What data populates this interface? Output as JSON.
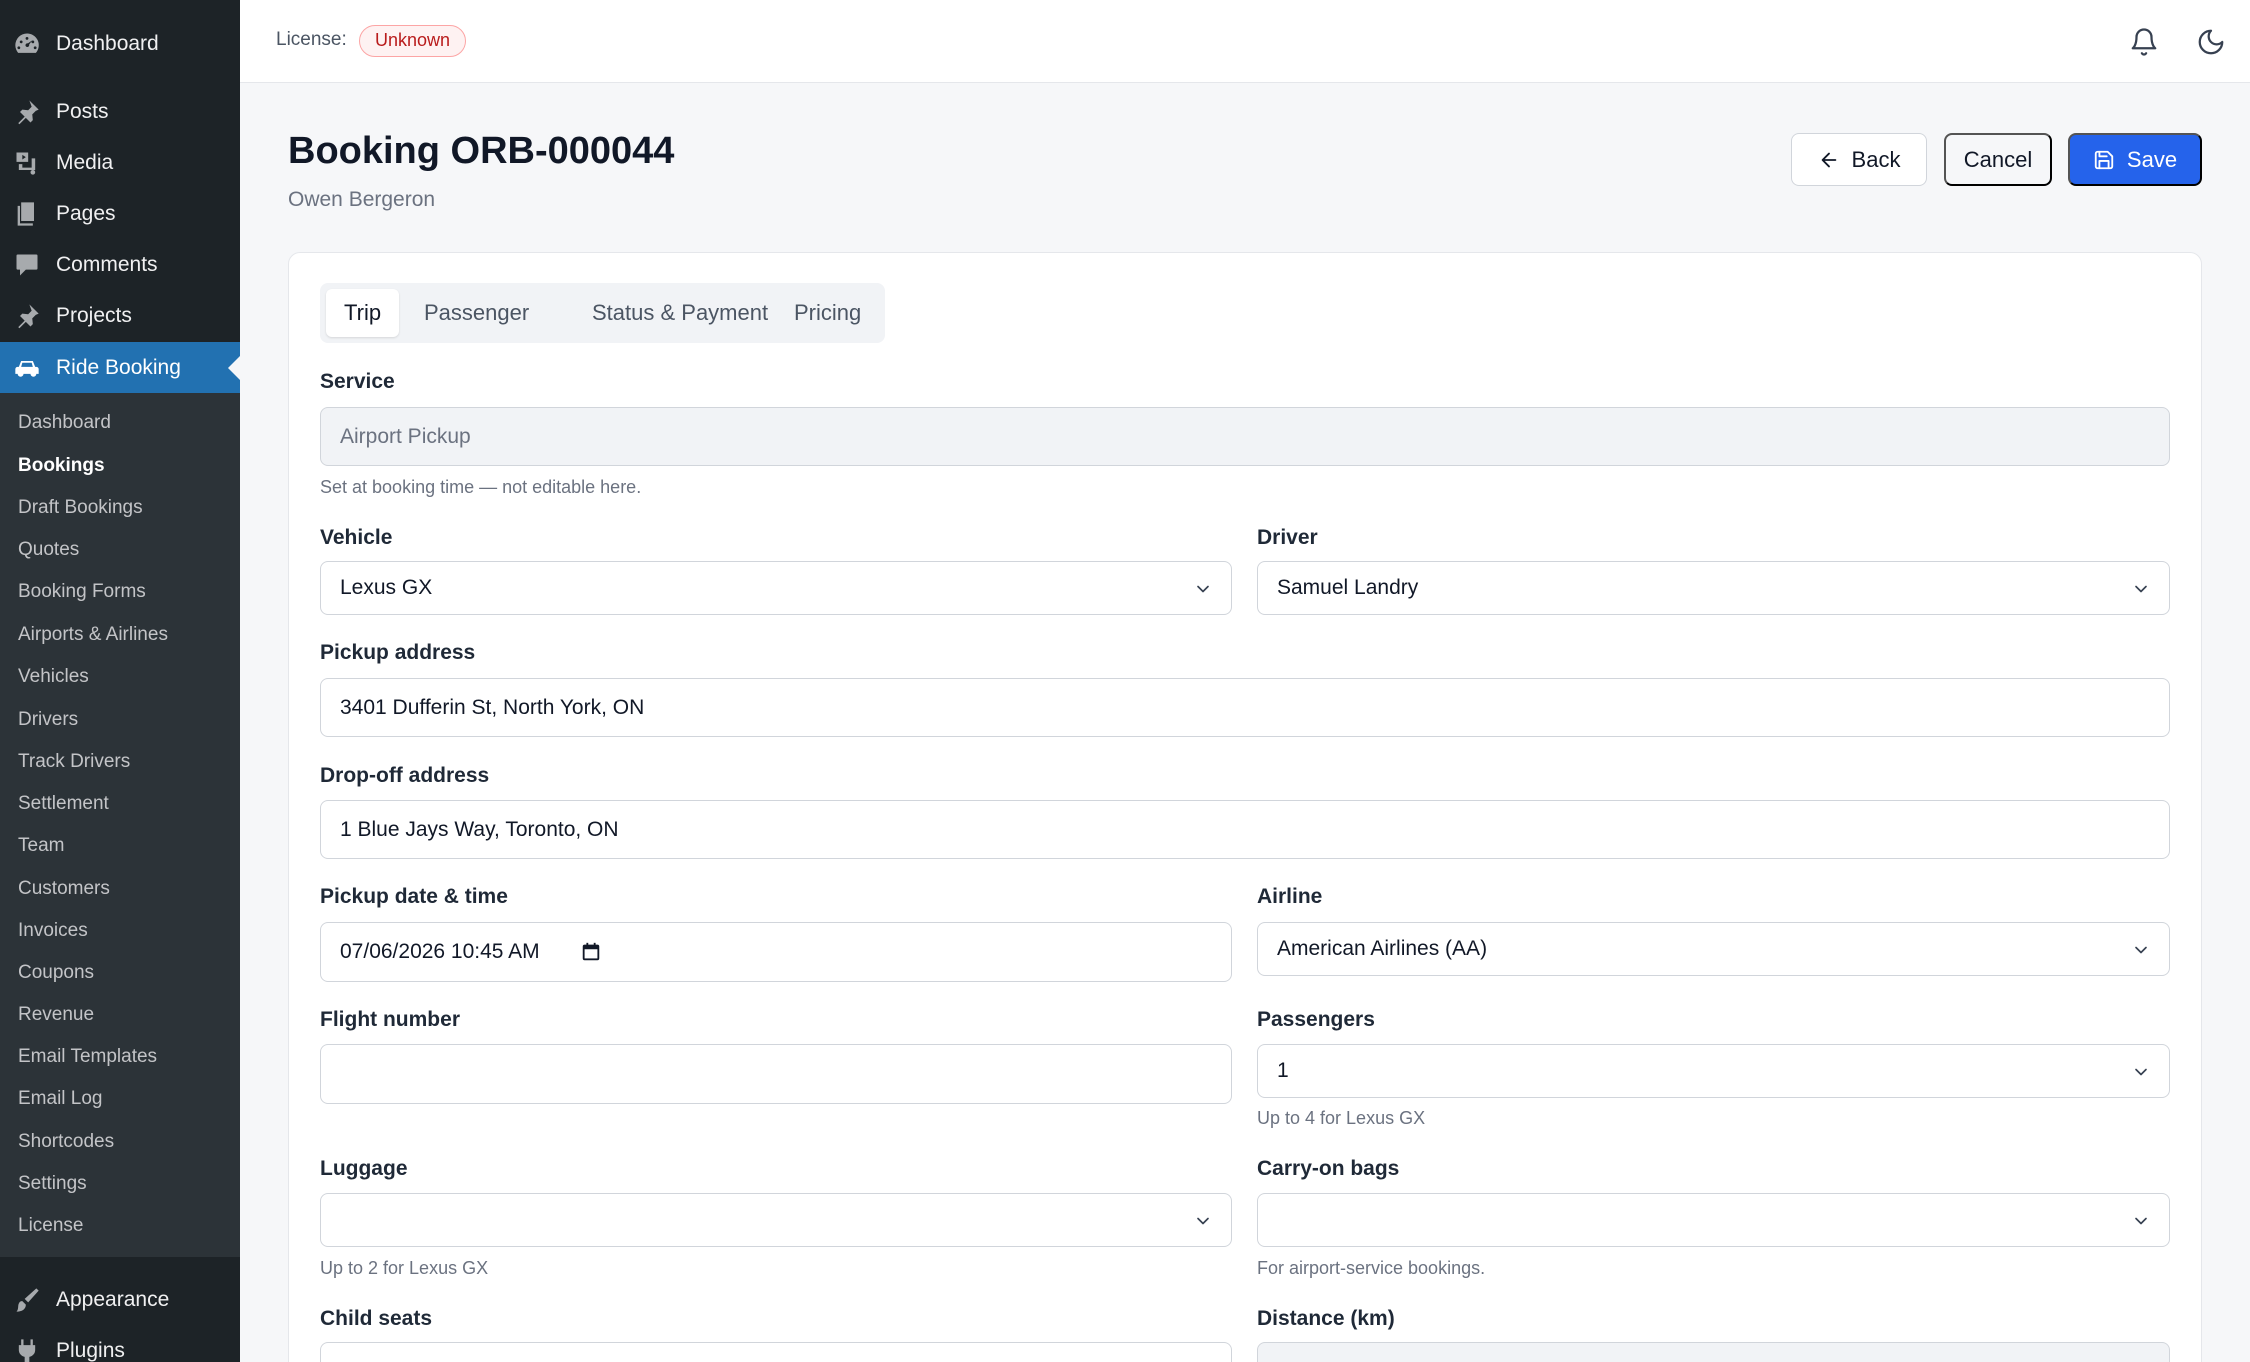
{
  "sidebar": {
    "menu": [
      {
        "label": "Dashboard",
        "icon": "dashboard-icon"
      },
      {
        "label": "Posts",
        "icon": "pin-icon"
      },
      {
        "label": "Media",
        "icon": "media-icon"
      },
      {
        "label": "Pages",
        "icon": "pages-icon"
      },
      {
        "label": "Comments",
        "icon": "comment-icon"
      },
      {
        "label": "Projects",
        "icon": "pin-icon"
      },
      {
        "label": "Ride Booking",
        "icon": "car-icon"
      }
    ],
    "submenu": [
      "Dashboard",
      "Bookings",
      "Draft Bookings",
      "Quotes",
      "Booking Forms",
      "Airports & Airlines",
      "Vehicles",
      "Drivers",
      "Track Drivers",
      "Settlement",
      "Team",
      "Customers",
      "Invoices",
      "Coupons",
      "Revenue",
      "Email Templates",
      "Email Log",
      "Shortcodes",
      "Settings",
      "License"
    ],
    "current_submenu": "Bookings",
    "bottom_menu": [
      {
        "label": "Appearance",
        "icon": "brush-icon"
      },
      {
        "label": "Plugins",
        "icon": "plugin-icon"
      }
    ]
  },
  "topbar": {
    "license_label": "License:",
    "license_status": "Unknown"
  },
  "header": {
    "title": "Booking ORB-000044",
    "subtitle": "Owen Bergeron",
    "back_label": "Back",
    "cancel_label": "Cancel",
    "save_label": "Save"
  },
  "tabs": [
    "Trip",
    "Passenger",
    "Status & Payment",
    "Pricing"
  ],
  "active_tab": "Trip",
  "form": {
    "service": {
      "label": "Service",
      "value": "Airport Pickup",
      "hint": "Set at booking time — not editable here."
    },
    "vehicle": {
      "label": "Vehicle",
      "value": "Lexus GX"
    },
    "driver": {
      "label": "Driver",
      "value": "Samuel Landry"
    },
    "pickup_address": {
      "label": "Pickup address",
      "value": "3401 Dufferin St, North York, ON"
    },
    "dropoff_address": {
      "label": "Drop-off address",
      "value": "1 Blue Jays Way, Toronto, ON"
    },
    "pickup_datetime": {
      "label": "Pickup date & time",
      "value": "07/06/2026 10:45 AM"
    },
    "airline": {
      "label": "Airline",
      "value": "American Airlines (AA)"
    },
    "flight_number": {
      "label": "Flight number",
      "value": ""
    },
    "passengers": {
      "label": "Passengers",
      "value": "1",
      "hint": "Up to 4 for Lexus GX"
    },
    "luggage": {
      "label": "Luggage",
      "value": "",
      "hint": "Up to 2 for Lexus GX"
    },
    "carry_on": {
      "label": "Carry-on bags",
      "value": "",
      "hint": "For airport-service bookings."
    },
    "child_seats": {
      "label": "Child seats"
    },
    "distance": {
      "label": "Distance (km)"
    }
  },
  "colors": {
    "sidebar_bg": "#1d2327",
    "sidebar_active": "#2271b1",
    "primary": "#2563eb",
    "badge_danger": "#b91c1c"
  }
}
